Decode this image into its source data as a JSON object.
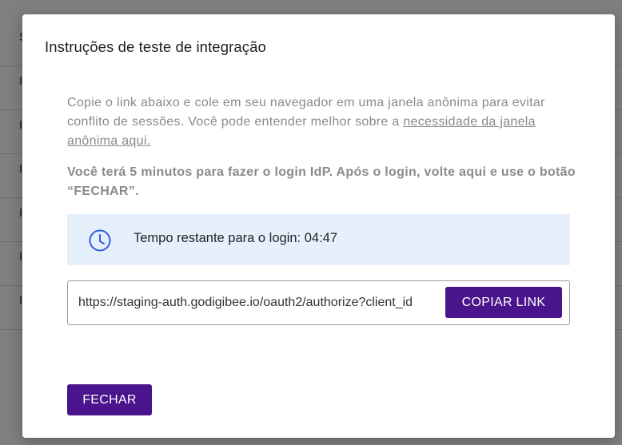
{
  "background": {
    "rows": [
      "S",
      "I",
      "I",
      "I",
      "I",
      "I",
      "I"
    ]
  },
  "modal": {
    "title": "Instruções de teste de integração",
    "instructions": {
      "text": "Copie o link abaixo e cole em seu navegador em uma janela anônima para evitar conflito de sessões. Você pode entender melhor sobre a ",
      "link_label": "necessidade da janela anônima aqui."
    },
    "notice": "Você terá 5 minutos para fazer o login IdP. Após o login, volte aqui e use o botão “FECHAR”.",
    "timer": {
      "icon": "clock-icon",
      "text": "Tempo restante para o login: 04:47"
    },
    "link_field": {
      "value": "https://staging-auth.godigibee.io/oauth2/authorize?client_id"
    },
    "copy_button_label": "COPIAR LINK",
    "close_button_label": "FECHAR"
  },
  "colors": {
    "primary": "#4a148c",
    "timer_background": "#e6f0fd",
    "timer_icon": "#2f5ed6",
    "muted_text": "#8a8a8a"
  }
}
